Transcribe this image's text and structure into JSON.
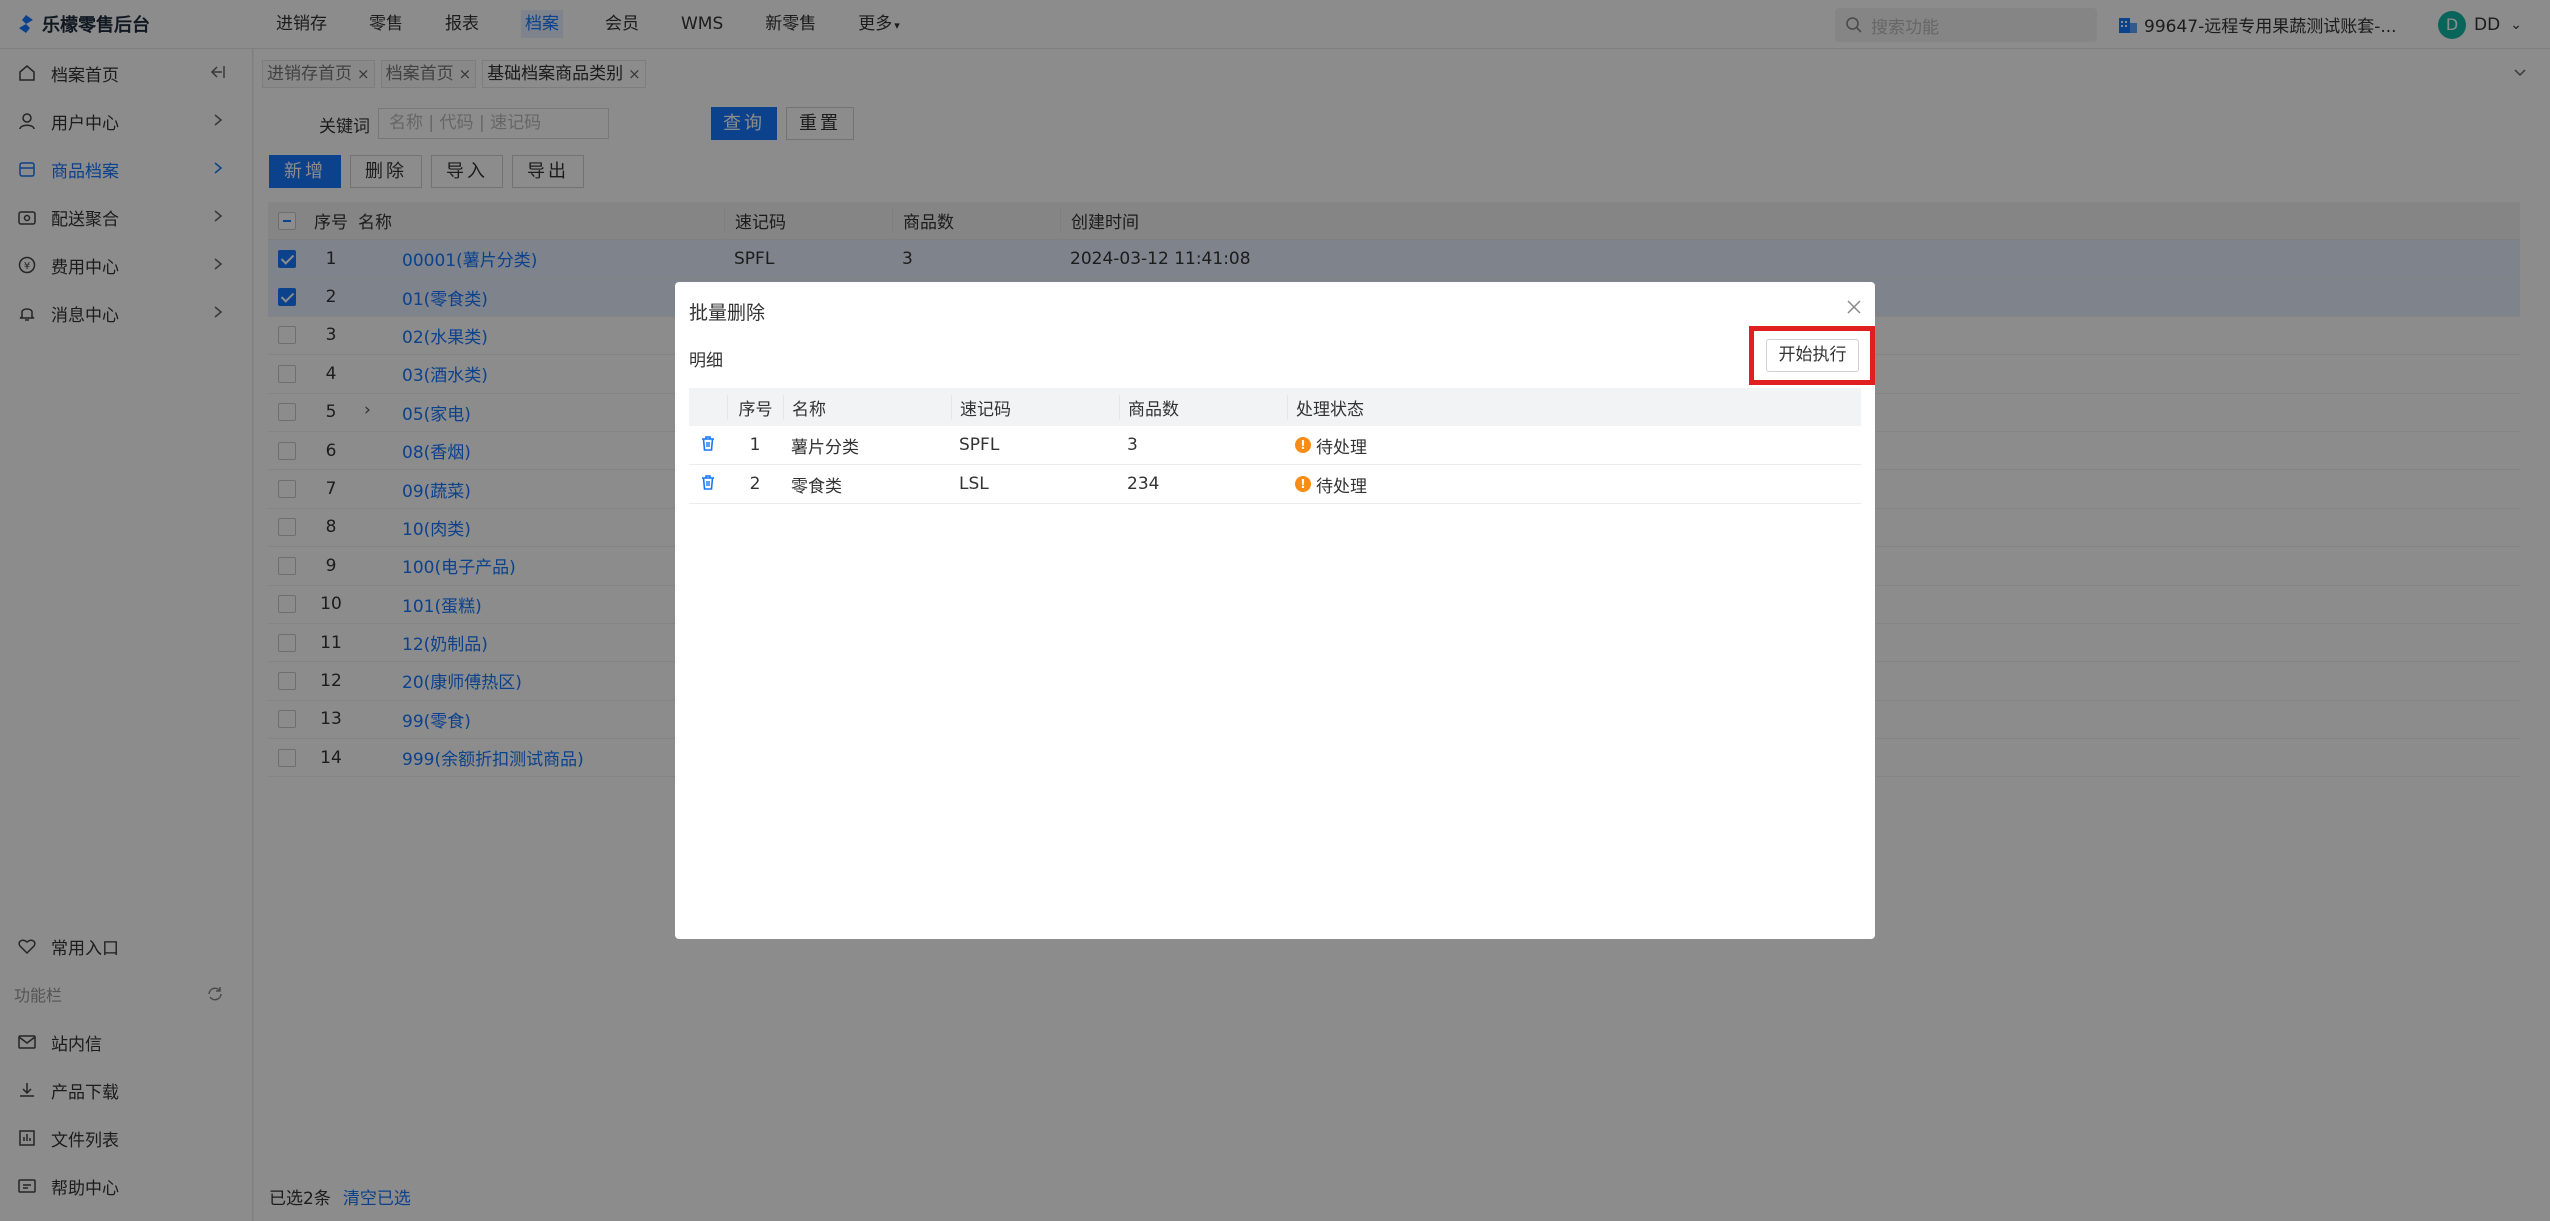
{
  "app": {
    "title": "乐檬零售后台"
  },
  "topnav": [
    {
      "label": "进销存"
    },
    {
      "label": "零售"
    },
    {
      "label": "报表"
    },
    {
      "label": "档案"
    },
    {
      "label": "会员"
    },
    {
      "label": "WMS"
    },
    {
      "label": "新零售"
    },
    {
      "label": "更多"
    }
  ],
  "header": {
    "search_placeholder": "搜索功能",
    "account": "99647-远程专用果蔬测试账套-...",
    "user_initial": "D",
    "user_name": "DD"
  },
  "sidebar": {
    "items": [
      {
        "label": "档案首页"
      },
      {
        "label": "用户中心"
      },
      {
        "label": "商品档案"
      },
      {
        "label": "配送聚合"
      },
      {
        "label": "费用中心"
      },
      {
        "label": "消息中心"
      }
    ],
    "favorites": "常用入口",
    "section": "功能栏",
    "tools": [
      {
        "label": "站内信"
      },
      {
        "label": "产品下载"
      },
      {
        "label": "文件列表"
      },
      {
        "label": "帮助中心"
      }
    ]
  },
  "tabs": [
    {
      "label": "进销存首页"
    },
    {
      "label": "档案首页"
    },
    {
      "label": "基础档案商品类别"
    }
  ],
  "filter": {
    "keyword_label": "关键词",
    "keyword_placeholder": "名称 | 代码 | 速记码",
    "query": "查询",
    "reset": "重置"
  },
  "toolbar": {
    "add": "新增",
    "delete": "删除",
    "import": "导入",
    "export": "导出"
  },
  "grid": {
    "headers": {
      "no": "序号",
      "name": "名称",
      "code": "速记码",
      "count": "商品数",
      "created": "创建时间"
    },
    "rows": [
      {
        "no": "1",
        "name": "00001(薯片分类)",
        "code": "SPFL",
        "count": "3",
        "created": "2024-03-12 11:41:08"
      },
      {
        "no": "2",
        "name": "01(零食类)",
        "code": "",
        "count": "",
        "created": ""
      },
      {
        "no": "3",
        "name": "02(水果类)",
        "code": "",
        "count": "",
        "created": ""
      },
      {
        "no": "4",
        "name": "03(酒水类)",
        "code": "",
        "count": "",
        "created": ""
      },
      {
        "no": "5",
        "name": "05(家电)",
        "code": "",
        "count": "",
        "created": ""
      },
      {
        "no": "6",
        "name": "08(香烟)",
        "code": "",
        "count": "",
        "created": ""
      },
      {
        "no": "7",
        "name": "09(蔬菜)",
        "code": "",
        "count": "",
        "created": ""
      },
      {
        "no": "8",
        "name": "10(肉类)",
        "code": "",
        "count": "",
        "created": ""
      },
      {
        "no": "9",
        "name": "100(电子产品)",
        "code": "",
        "count": "",
        "created": ""
      },
      {
        "no": "10",
        "name": "101(蛋糕)",
        "code": "",
        "count": "",
        "created": ""
      },
      {
        "no": "11",
        "name": "12(奶制品)",
        "code": "",
        "count": "",
        "created": ""
      },
      {
        "no": "12",
        "name": "20(康师傅热区)",
        "code": "",
        "count": "",
        "created": ""
      },
      {
        "no": "13",
        "name": "99(零食)",
        "code": "",
        "count": "",
        "created": ""
      },
      {
        "no": "14",
        "name": "999(余额折扣测试商品)",
        "code": "",
        "count": "",
        "created": ""
      }
    ]
  },
  "footer": {
    "selected": "已选2条",
    "clear": "清空已选"
  },
  "modal": {
    "title": "批量删除",
    "subtitle": "明细",
    "exec_button": "开始执行",
    "headers": {
      "no": "序号",
      "name": "名称",
      "code": "速记码",
      "count": "商品数",
      "status": "处理状态"
    },
    "rows": [
      {
        "no": "1",
        "name": "薯片分类",
        "code": "SPFL",
        "count": "3",
        "status": "待处理"
      },
      {
        "no": "2",
        "name": "零食类",
        "code": "LSL",
        "count": "234",
        "status": "待处理"
      }
    ]
  },
  "colors": {
    "primary": "#1677ff",
    "warning": "#fa8c16",
    "highlight": "#e02020",
    "avatar": "#12b7a5"
  }
}
